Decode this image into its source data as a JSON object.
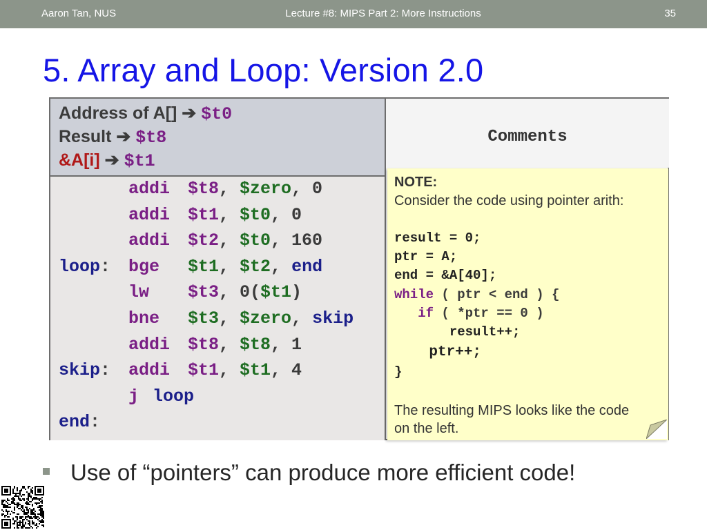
{
  "header": {
    "author": "Aaron Tan, NUS",
    "lecture": "Lecture #8: MIPS Part 2: More Instructions",
    "page_number": "35"
  },
  "title": "5. Array and Loop: Version 2.0",
  "table": {
    "register_header": [
      {
        "label": "Address of A[]",
        "register": "$t0"
      },
      {
        "label": "Result",
        "register": "$t8"
      },
      {
        "label": "&A[i]",
        "register": "$t1"
      }
    ],
    "arrow": "➔",
    "comments_header": "Comments",
    "code": [
      {
        "label": "",
        "op": "addi",
        "args": [
          {
            "t": "$t8",
            "c": "purple"
          },
          {
            "t": ", ",
            "c": "dark"
          },
          {
            "t": "$zero",
            "c": "green"
          },
          {
            "t": ", 0",
            "c": "dark"
          }
        ]
      },
      {
        "label": "",
        "op": "addi",
        "args": [
          {
            "t": "$t1",
            "c": "purple"
          },
          {
            "t": ", ",
            "c": "dark"
          },
          {
            "t": "$t0",
            "c": "green"
          },
          {
            "t": ", 0",
            "c": "dark"
          }
        ]
      },
      {
        "label": "",
        "op": "addi",
        "args": [
          {
            "t": "$t2",
            "c": "purple"
          },
          {
            "t": ", ",
            "c": "dark"
          },
          {
            "t": "$t0",
            "c": "green"
          },
          {
            "t": ", 160",
            "c": "dark"
          }
        ]
      },
      {
        "label": "loop:",
        "op": "bge",
        "args": [
          {
            "t": "$t1",
            "c": "green"
          },
          {
            "t": ", ",
            "c": "dark"
          },
          {
            "t": "$t2",
            "c": "green"
          },
          {
            "t": ", ",
            "c": "dark"
          },
          {
            "t": "end",
            "c": "blue"
          }
        ]
      },
      {
        "label": "",
        "op": "lw",
        "args": [
          {
            "t": "$t3",
            "c": "purple"
          },
          {
            "t": ", 0(",
            "c": "dark"
          },
          {
            "t": "$t1",
            "c": "green"
          },
          {
            "t": ")",
            "c": "dark"
          }
        ]
      },
      {
        "label": "",
        "op": "bne",
        "args": [
          {
            "t": "$t3",
            "c": "green"
          },
          {
            "t": ", ",
            "c": "dark"
          },
          {
            "t": "$zero",
            "c": "green"
          },
          {
            "t": ", ",
            "c": "dark"
          },
          {
            "t": "skip",
            "c": "blue"
          }
        ]
      },
      {
        "label": "",
        "op": "addi",
        "args": [
          {
            "t": "$t8",
            "c": "purple"
          },
          {
            "t": ", ",
            "c": "dark"
          },
          {
            "t": "$t8",
            "c": "green"
          },
          {
            "t": ", 1",
            "c": "dark"
          }
        ]
      },
      {
        "label": "skip:",
        "op": "addi",
        "args": [
          {
            "t": "$t1",
            "c": "purple"
          },
          {
            "t": ", ",
            "c": "dark"
          },
          {
            "t": "$t1",
            "c": "green"
          },
          {
            "t": ", 4",
            "c": "dark"
          }
        ]
      },
      {
        "label": "",
        "op": "j",
        "args": [
          {
            "t": "loop",
            "c": "blue"
          }
        ]
      },
      {
        "label": "end:",
        "op": "",
        "args": []
      }
    ]
  },
  "note": {
    "heading": "NOTE:",
    "intro": "Consider the code using pointer arith:",
    "code_lines": [
      {
        "text": "result = 0;",
        "color": "dark"
      },
      {
        "text": "ptr = A;",
        "color": "dark"
      },
      {
        "text": "end = &A[40];",
        "color": "dark"
      },
      {
        "text": "",
        "parts": [
          {
            "t": "while",
            "c": "purple"
          },
          {
            "t": " ( ptr < end ) {",
            "c": "dark"
          }
        ]
      },
      {
        "text": "",
        "parts": [
          {
            "t": "   if",
            "c": "purple"
          },
          {
            "t": " ( *ptr == 0 )",
            "c": "dark"
          }
        ]
      },
      {
        "text": "       result++;",
        "color": "dark"
      },
      {
        "text": "    ptr++;",
        "color": "red"
      },
      {
        "text": "}",
        "color": "purple"
      }
    ],
    "outro": [
      "The resulting MIPS looks like the code",
      "on the left."
    ]
  },
  "bullet": "Use of “pointers” can produce more efficient code!",
  "colors": {
    "header_bar": "#8c958a",
    "title": "#1515e6",
    "register_header_bg": "#cdd0d8",
    "note_bg": "#ffffc9",
    "purple": "#7a1f85",
    "green": "#1e6d22",
    "blue": "#1b1f8a",
    "red": "#b01818"
  }
}
